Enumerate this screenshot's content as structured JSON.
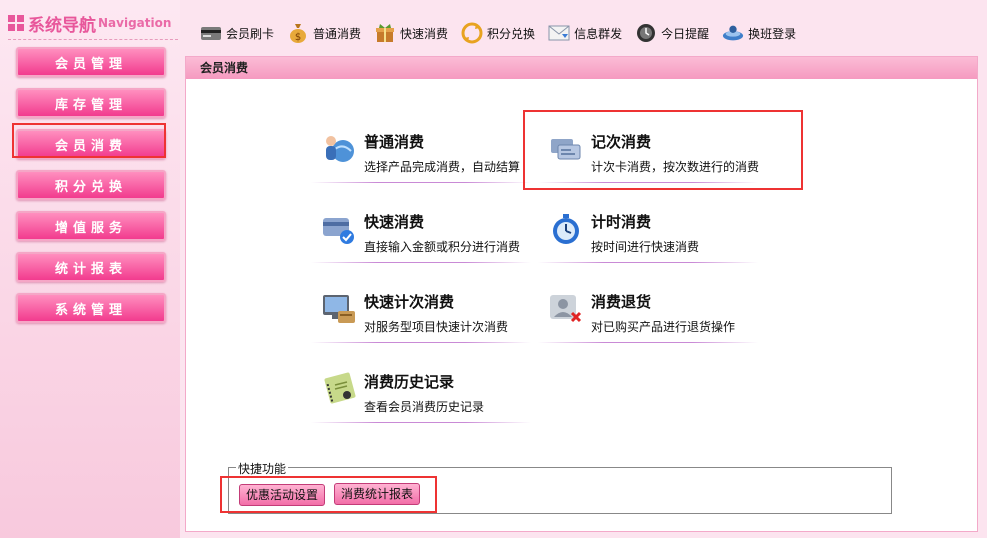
{
  "nav": {
    "title": "系统导航",
    "title_en": "Navigation",
    "items": [
      {
        "label": "会员管理"
      },
      {
        "label": "库存管理"
      },
      {
        "label": "会员消费"
      },
      {
        "label": "积分兑换"
      },
      {
        "label": "增值服务"
      },
      {
        "label": "统计报表"
      },
      {
        "label": "系统管理"
      }
    ],
    "selected": "会员消费"
  },
  "toolbar": {
    "items": [
      {
        "label": "会员刷卡",
        "icon": "card-reader-icon"
      },
      {
        "label": "普通消费",
        "icon": "money-bag-icon"
      },
      {
        "label": "快速消费",
        "icon": "gift-box-icon"
      },
      {
        "label": "积分兑换",
        "icon": "exchange-arrows-icon"
      },
      {
        "label": "信息群发",
        "icon": "envelope-icon"
      },
      {
        "label": "今日提醒",
        "icon": "clock-icon"
      },
      {
        "label": "换班登录",
        "icon": "person-login-icon"
      }
    ]
  },
  "panel": {
    "title": "会员消费",
    "functions": [
      {
        "title": "普通消费",
        "desc": "选择产品完成消费，自动结算",
        "icon": "people-globe-icon"
      },
      {
        "title": "记次消费",
        "desc": "计次卡消费，按次数进行的消费",
        "icon": "cards-icon"
      },
      {
        "title": "快速消费",
        "desc": "直接输入金额或积分进行消费",
        "icon": "check-card-icon"
      },
      {
        "title": "计时消费",
        "desc": "按时间进行快速消费",
        "icon": "stopwatch-icon"
      },
      {
        "title": "快速计次消费",
        "desc": "对服务型项目快速计次消费",
        "icon": "monitor-icon"
      },
      {
        "title": "消费退货",
        "desc": "对已购买产品进行退货操作",
        "icon": "user-remove-icon"
      },
      {
        "title": "消费历史记录",
        "desc": "查看会员消费历史记录",
        "icon": "notebook-icon"
      }
    ],
    "highlighted": "记次消费"
  },
  "quick": {
    "legend": "快捷功能",
    "buttons": [
      {
        "label": "优惠活动设置"
      },
      {
        "label": "消费统计报表"
      }
    ]
  },
  "colors": {
    "accent": "#f23b8e",
    "background": "#fce4ef",
    "highlight_border": "#ee3333"
  }
}
